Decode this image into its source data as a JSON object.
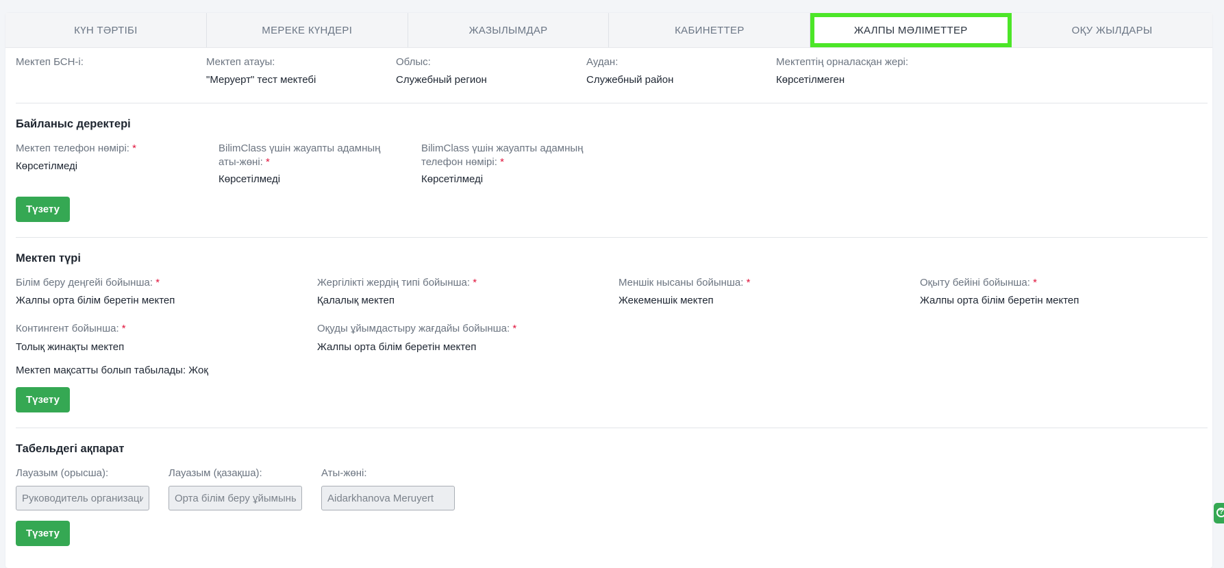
{
  "tabs": [
    {
      "label": "КҮН ТӘРТІБІ"
    },
    {
      "label": "МЕРЕКЕ КҮНДЕРІ"
    },
    {
      "label": "ЖАЗЫЛЫМДАР"
    },
    {
      "label": "КАБИНЕТТЕР"
    },
    {
      "label": "ЖАЛПЫ МӘЛІМЕТТЕР"
    },
    {
      "label": "ОҚУ ЖЫЛДАРЫ"
    }
  ],
  "active_tab": "ЖАЛПЫ МӘЛІМЕТТЕР",
  "highlight_color": "#4ce628",
  "accent_color": "#35a853",
  "school": {
    "bin_label": "Мектеп БСН-і:",
    "bin_value": "",
    "name_label": "Мектеп атауы:",
    "name_value": "\"Меруерт\" тест мектебі",
    "region_label": "Облыс:",
    "region_value": "Служебный регион",
    "district_label": "Аудан:",
    "district_value": "Служебный район",
    "location_label": "Мектептің орналасқан жері:",
    "location_value": "Көрсетілмеген"
  },
  "contacts": {
    "title": "Байланыс деректері",
    "phone_label": "Мектеп телефон нөмірі:",
    "phone_value": "Көрсетілмеді",
    "resp_name_label_1": "BilimClass үшін жауапты адамның",
    "resp_name_label_2": "аты-жөні:",
    "resp_name_value": "Көрсетілмеді",
    "resp_phone_label_1": "BilimClass үшін жауапты адамның",
    "resp_phone_label_2": "телефон нөмірі:",
    "resp_phone_value": "Көрсетілмеді",
    "required_mark": "*",
    "edit_button": "Түзету"
  },
  "school_type": {
    "title": "Мектеп түрі",
    "edu_level_label": "Білім беру деңгейі бойынша:",
    "edu_level_value": "Жалпы орта білім беретін мектеп",
    "locality_label": "Жергілікті жердің типі бойынша:",
    "locality_value": "Қалалық мектеп",
    "ownership_label": "Меншік нысаны бойынша:",
    "ownership_value": "Жекеменшік мектеп",
    "profile_label": "Оқыту бейіні бойынша:",
    "profile_value": "Жалпы орта білім беретін мектеп",
    "contingent_label": "Контингент бойынша:",
    "contingent_value": "Толық жинақты мектеп",
    "organization_label": "Оқуды ұйымдастыру жағдайы бойынша:",
    "organization_value": "Жалпы орта білім беретін мектеп",
    "target_text": "Мектеп мақсатты болып табылады: Жоқ",
    "required_mark": "*",
    "edit_button": "Түзету"
  },
  "tabel": {
    "title": "Табельдегі ақпарат",
    "position_ru_label": "Лауазым (орысша):",
    "position_ru_value": "Руководитель организации",
    "position_kz_label": "Лауазым (қазақша):",
    "position_kz_value": "Орта білім беру ұйымының басшысы",
    "fullname_label": "Аты-жөні:",
    "fullname_value": "Aidarkhanova Meruyert",
    "edit_button": "Түзету"
  }
}
